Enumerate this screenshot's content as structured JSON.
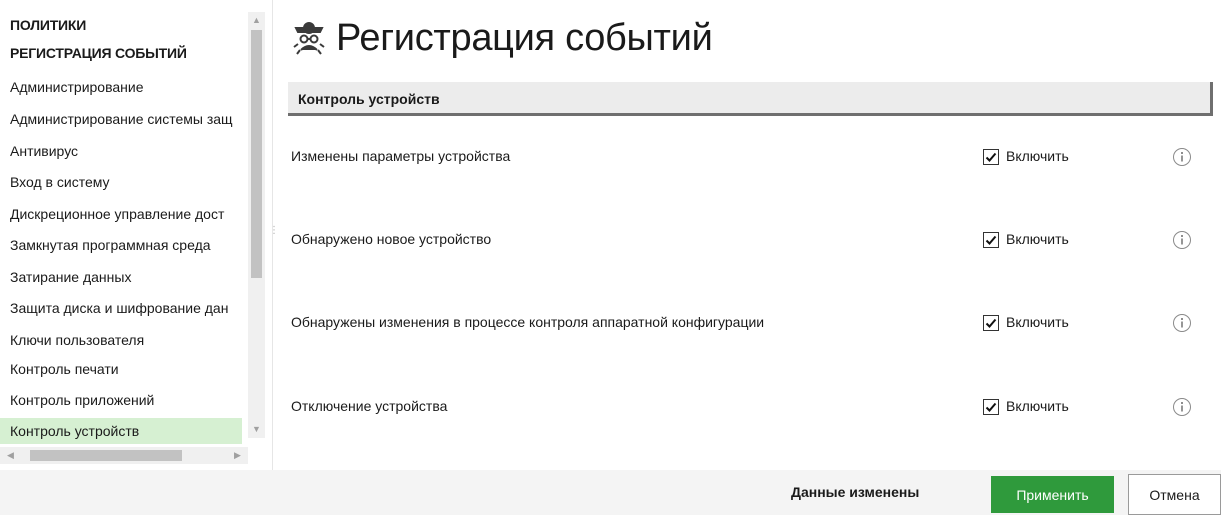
{
  "nav": {
    "heading_policies": "ПОЛИТИКИ",
    "heading_events": "РЕГИСТРАЦИЯ СОБЫТИЙ",
    "items": [
      {
        "label": "Администрирование"
      },
      {
        "label": "Администрирование системы защ"
      },
      {
        "label": "Антивирус"
      },
      {
        "label": "Вход в систему"
      },
      {
        "label": "Дискреционное управление дост"
      },
      {
        "label": "Замкнутая программная среда"
      },
      {
        "label": "Затирание данных"
      },
      {
        "label": "Защита диска и шифрование дан"
      },
      {
        "label": "Ключи пользователя"
      },
      {
        "label": "Контроль печати"
      },
      {
        "label": "Контроль приложений"
      },
      {
        "label": "Контроль устройств"
      }
    ],
    "selected_item": "Контроль устройств"
  },
  "main": {
    "title": "Регистрация событий",
    "title_icon": "event-log-icon",
    "section_title": "Контроль устройств",
    "events": [
      {
        "label": "Изменены параметры устройства",
        "checkbox_label": "Включить",
        "checked": true
      },
      {
        "label": "Обнаружено новое устройство",
        "checkbox_label": "Включить",
        "checked": true
      },
      {
        "label": "Обнаружены изменения в процессе контроля аппаратной конфигурации",
        "checkbox_label": "Включить",
        "checked": true
      },
      {
        "label": "Отключение устройства",
        "checkbox_label": "Включить",
        "checked": true
      }
    ]
  },
  "footer": {
    "status": "Данные изменены",
    "apply_label": "Применить",
    "cancel_label": "Отмена"
  },
  "colors": {
    "accent_green": "#2f9a3c",
    "selected_bg": "#d6f0d2",
    "section_bg": "#ececec"
  }
}
